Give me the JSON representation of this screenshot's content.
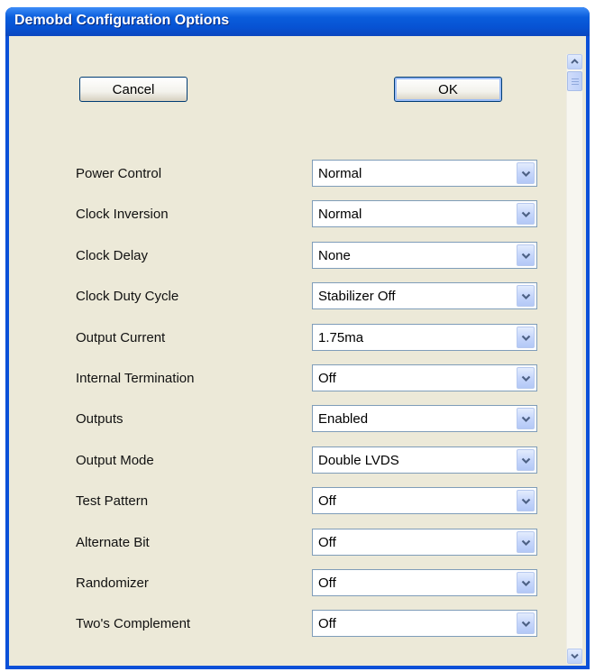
{
  "window": {
    "title": "Demobd Configuration Options"
  },
  "buttons": {
    "cancel": "Cancel",
    "ok": "OK"
  },
  "options": [
    {
      "label": "Power Control",
      "value": "Normal"
    },
    {
      "label": "Clock Inversion",
      "value": "Normal"
    },
    {
      "label": "Clock Delay",
      "value": "None"
    },
    {
      "label": "Clock Duty Cycle",
      "value": "Stabilizer Off"
    },
    {
      "label": "Output Current",
      "value": "1.75ma"
    },
    {
      "label": "Internal Termination",
      "value": "Off"
    },
    {
      "label": "Outputs",
      "value": "Enabled"
    },
    {
      "label": "Output Mode",
      "value": "Double LVDS"
    },
    {
      "label": "Test Pattern",
      "value": "Off"
    },
    {
      "label": "Alternate Bit",
      "value": "Off"
    },
    {
      "label": "Randomizer",
      "value": "Off"
    },
    {
      "label": "Two's Complement",
      "value": "Off"
    }
  ],
  "colors": {
    "title_bar": "#0a5ddc",
    "client_bg": "#ece9d8",
    "combo_border": "#7f9db9"
  },
  "icons": {
    "dropdown": "chevron-down-icon",
    "scroll_up": "scroll-up-arrow-icon",
    "scroll_down": "scroll-down-arrow-icon"
  }
}
